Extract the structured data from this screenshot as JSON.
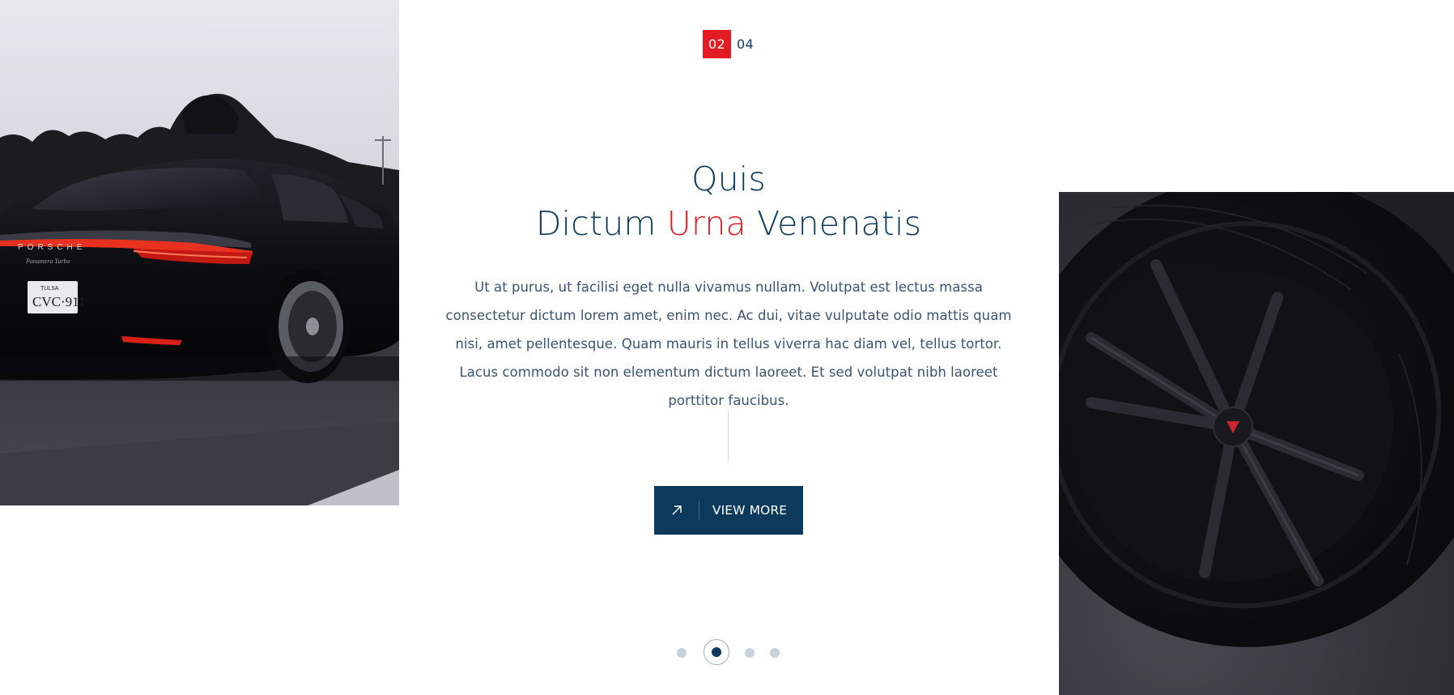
{
  "slider": {
    "current": "02",
    "total": "04",
    "active_index": 2,
    "dot_count": 4
  },
  "hero": {
    "title_line1": "Quis",
    "title_line2_part1": "Dictum ",
    "title_line2_accent": "Urna",
    "title_line2_part2": " Venenatis",
    "paragraph": "Ut at purus, ut facilisi eget nulla vivamus nullam. Volutpat est lectus massa consectetur dictum lorem amet, enim nec. Ac dui, vitae vulputate odio mattis quam nisi, amet pellentesque. Quam mauris in tellus viverra hac diam vel, tellus tortor. Lacus commodo sit non elementum dictum laoreet. Et sed volutpat nibh laoreet porttitor faucibus."
  },
  "button": {
    "label": "VIEW MORE",
    "icon": "arrow-up-right-icon"
  },
  "images": {
    "left": "car-rear-photo",
    "right": "wheel-closeup-photo"
  },
  "colors": {
    "primary": "#0d3a5c",
    "accent": "#e31b23",
    "text": "#3a5470",
    "dot_inactive": "#c7d2dc"
  }
}
